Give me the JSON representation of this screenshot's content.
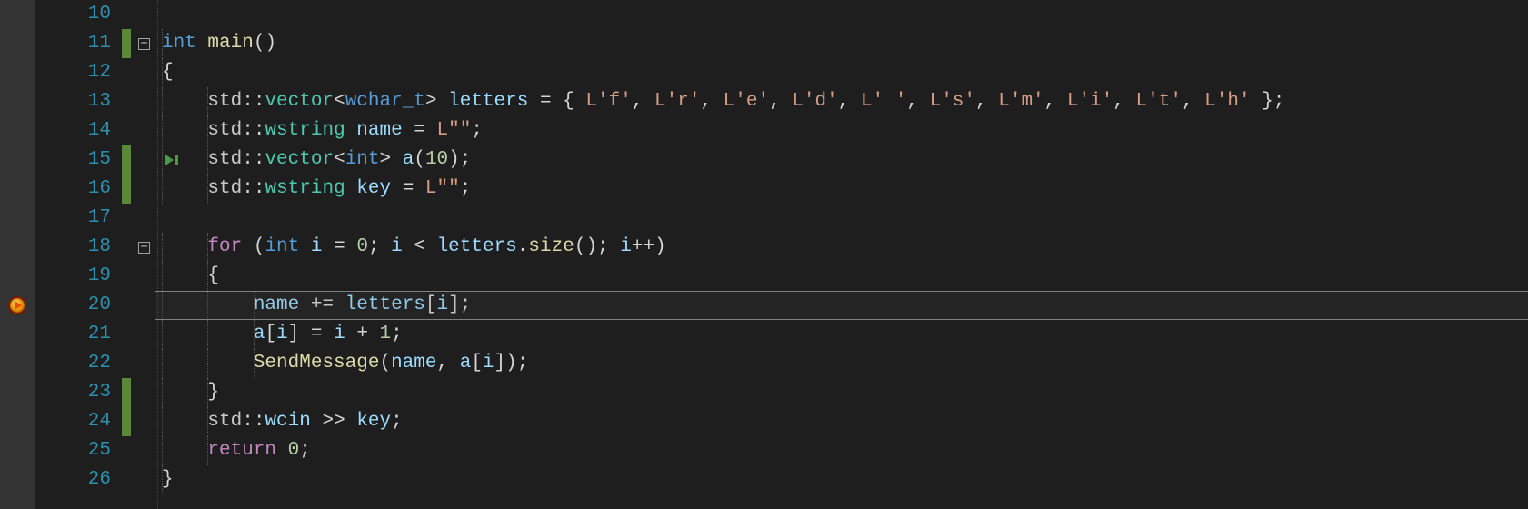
{
  "editor": {
    "first_line": 10,
    "current_line": 20,
    "lines": [
      {
        "n": 10,
        "code": ""
      },
      {
        "n": 11,
        "code": "int main()",
        "fold": "minus"
      },
      {
        "n": 12,
        "code": "{"
      },
      {
        "n": 13,
        "code": "    std::vector<wchar_t> letters = { L'f', L'r', L'e', L'd', L' ', L's', L'm', L'i', L't', L'h' };"
      },
      {
        "n": 14,
        "code": "    std::wstring name = L\"\";"
      },
      {
        "n": 15,
        "code": "    std::vector<int> a(10);",
        "play": true
      },
      {
        "n": 16,
        "code": "    std::wstring key = L\"\";"
      },
      {
        "n": 17,
        "code": ""
      },
      {
        "n": 18,
        "code": "    for (int i = 0; i < letters.size(); i++)",
        "fold": "minus"
      },
      {
        "n": 19,
        "code": "    {"
      },
      {
        "n": 20,
        "code": "        name += letters[i];",
        "breakpoint": true,
        "current": true
      },
      {
        "n": 21,
        "code": "        a[i] = i + 1;"
      },
      {
        "n": 22,
        "code": "        SendMessage(name, a[i]);"
      },
      {
        "n": 23,
        "code": "    }"
      },
      {
        "n": 24,
        "code": "    std::wcin >> key;"
      },
      {
        "n": 25,
        "code": "    return 0;"
      },
      {
        "n": 26,
        "code": "}"
      }
    ],
    "change_bars": [
      {
        "start": 11,
        "end": 11
      },
      {
        "start": 15,
        "end": 16
      },
      {
        "start": 23,
        "end": 24
      }
    ],
    "line_height": 32,
    "indent_width": 12.6
  },
  "colors": {
    "background": "#1e1e1e",
    "gutter": "#333333",
    "line_number": "#2b91af",
    "change_bar": "#5a8838"
  }
}
